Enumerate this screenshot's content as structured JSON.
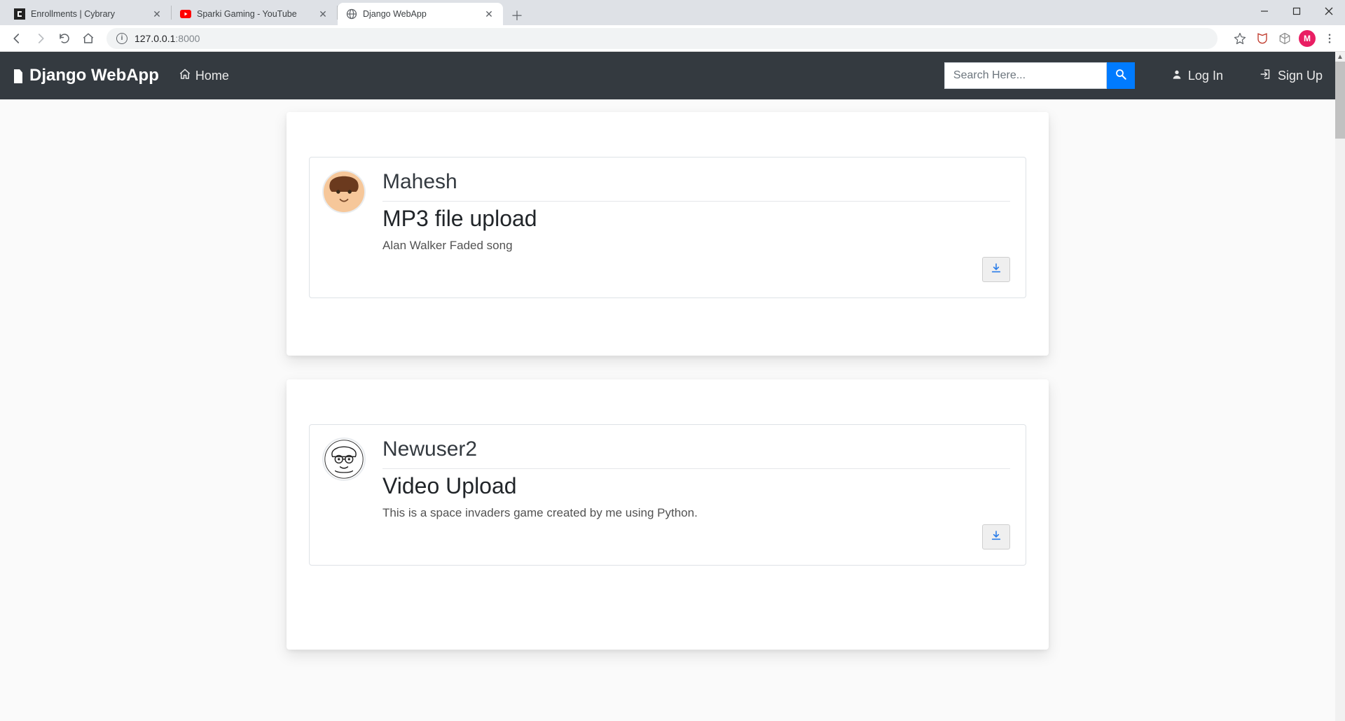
{
  "browser": {
    "tabs": [
      {
        "title": "Enrollments | Cybrary"
      },
      {
        "title": "Sparki Gaming - YouTube"
      },
      {
        "title": "Django WebApp"
      }
    ],
    "active_tab_index": 2,
    "url_host": "127.0.0.1",
    "url_port": ":8000",
    "profile_initial": "M"
  },
  "navbar": {
    "brand": "Django WebApp",
    "home": "Home",
    "search_placeholder": "Search Here...",
    "login": "Log In",
    "signup": "Sign Up"
  },
  "posts": [
    {
      "user": "Mahesh",
      "title": "MP3 file upload",
      "description": "Alan Walker Faded song"
    },
    {
      "user": "Newuser2",
      "title": "Video Upload",
      "description": "This is a space invaders game created by me using Python."
    }
  ]
}
